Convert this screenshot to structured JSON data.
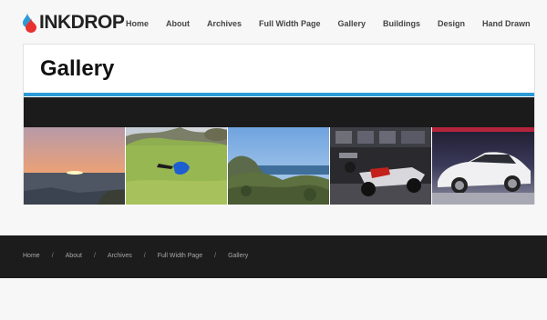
{
  "site": {
    "logo_text": "INKDROP",
    "logo_colors": {
      "red": "#e8322f",
      "blue": "#2c9ad7"
    }
  },
  "nav": {
    "items": [
      {
        "label": "Home"
      },
      {
        "label": "About"
      },
      {
        "label": "Archives"
      },
      {
        "label": "Full Width Page"
      },
      {
        "label": "Gallery"
      },
      {
        "label": "Buildings"
      },
      {
        "label": "Design"
      },
      {
        "label": "Hand Drawn"
      }
    ]
  },
  "page": {
    "title": "Gallery",
    "accent": "#2c9ad7"
  },
  "gallery": {
    "images": [
      {
        "subject": "sunset-over-sea"
      },
      {
        "subject": "grass-field-with-bag"
      },
      {
        "subject": "coastal-hills"
      },
      {
        "subject": "race-car-in-pit"
      },
      {
        "subject": "white-sports-car"
      }
    ]
  },
  "footer": {
    "breadcrumb": [
      {
        "label": "Home"
      },
      {
        "label": "About"
      },
      {
        "label": "Archives"
      },
      {
        "label": "Full Width Page"
      },
      {
        "label": "Gallery"
      }
    ],
    "separator": "/"
  }
}
